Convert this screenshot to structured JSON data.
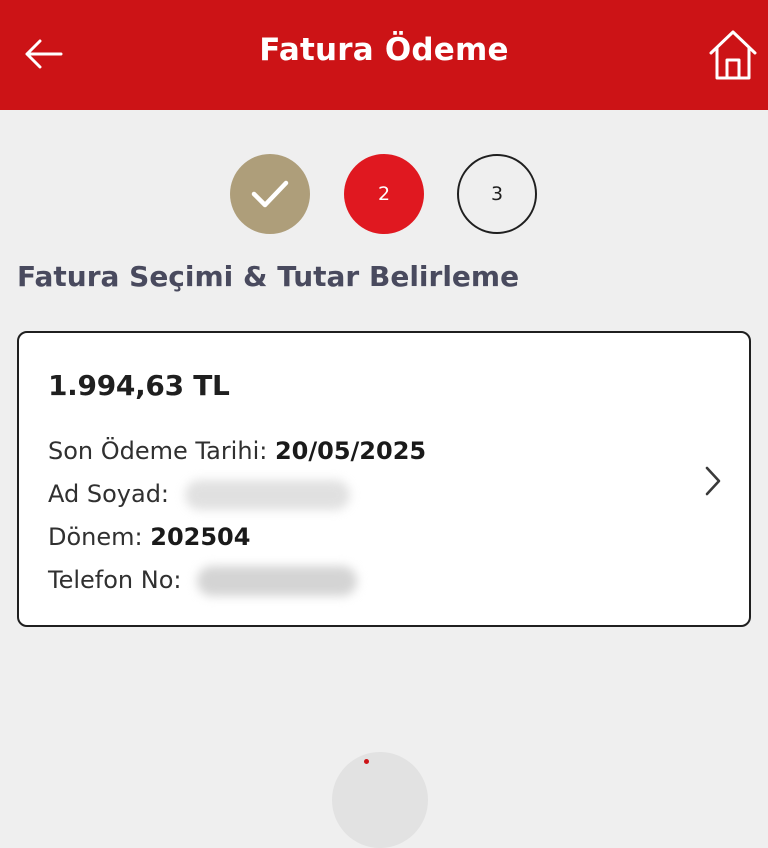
{
  "header": {
    "title": "Fatura Ödeme",
    "back_icon": "arrow-left-icon",
    "home_icon": "home-icon",
    "color": "#cc1316"
  },
  "steps": [
    {
      "label": "",
      "state": "completed",
      "icon": "check-icon",
      "color": "#ae9e7a"
    },
    {
      "label": "2",
      "state": "active",
      "color": "#e01820"
    },
    {
      "label": "3",
      "state": "pending"
    }
  ],
  "section_title": "Fatura Seçimi & Tutar Belirleme",
  "bill": {
    "amount": "1.994,63 TL",
    "due_date_label": "Son Ödeme Tarihi:",
    "due_date": "20/05/2025",
    "name_label": "Ad Soyad:",
    "period_label": "Dönem:",
    "period": "202504",
    "phone_label": "Telefon No:",
    "chevron_icon": "chevron-right-icon"
  }
}
